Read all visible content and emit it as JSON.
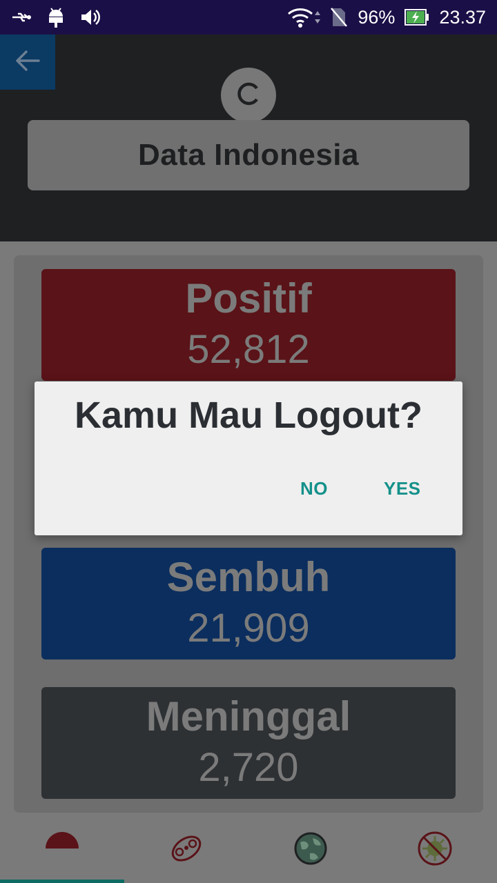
{
  "status_bar": {
    "battery_percent": "96%",
    "time": "23.37",
    "icons": [
      "usb-icon",
      "android-icon",
      "volume-icon",
      "wifi-icon",
      "no-sim-icon",
      "battery-charging-icon"
    ]
  },
  "header": {
    "title": "Data Indonesia",
    "back_icon": "arrow-left-icon",
    "refresh_icon": "refresh-icon"
  },
  "stats": {
    "positif": {
      "label": "Positif",
      "value": "52,812"
    },
    "sembuh": {
      "label": "Sembuh",
      "value": "21,909"
    },
    "meninggal": {
      "label": "Meninggal",
      "value": "2,720"
    }
  },
  "dialog": {
    "title": "Kamu Mau Logout?",
    "no_label": "NO",
    "yes_label": "YES"
  },
  "bottom_nav": {
    "items": [
      {
        "icon": "indonesia-flag-icon",
        "active": true
      },
      {
        "icon": "hospital-map-icon",
        "active": false
      },
      {
        "icon": "globe-icon",
        "active": false
      },
      {
        "icon": "virus-icon",
        "active": false
      }
    ]
  },
  "colors": {
    "accent": "#14918a",
    "positif": "#5a1318",
    "sembuh": "#0b2e5e",
    "meninggal": "#2e3134"
  }
}
